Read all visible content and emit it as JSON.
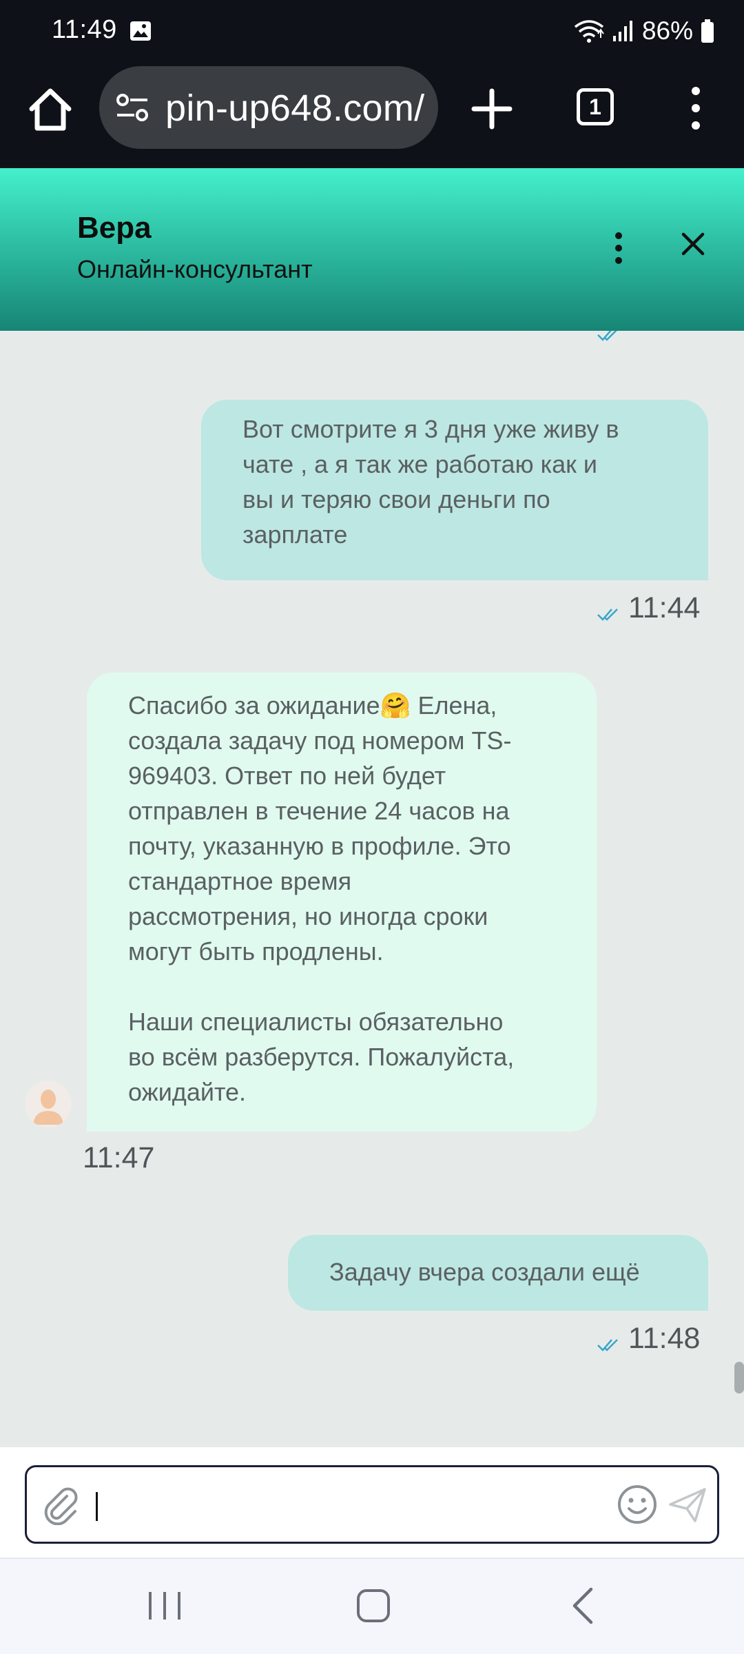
{
  "status_bar": {
    "time": "11:49",
    "battery": "86%"
  },
  "browser": {
    "url": "pin-up648.com/",
    "tab_count": "1"
  },
  "chat_header": {
    "agent_name": "Вера",
    "agent_role": "Онлайн-консультант"
  },
  "messages": [
    {
      "direction": "out",
      "lines": [
        "Вот смотрите я 3 дня уже живу в",
        "чате , а я так же работаю как и",
        "вы и теряю свои деньги по",
        "зарплате"
      ],
      "time": "11:44"
    },
    {
      "direction": "in",
      "lines": [
        "Спасибо за ожидание🤗 Елена,",
        "создала задачу под номером TS-",
        "969403. Ответ по ней будет",
        "отправлен в течение 24 часов на",
        "почту, указанную в профиле. Это",
        "стандартное время",
        "рассмотрения, но иногда сроки",
        "могут быть продлены."
      ],
      "lines2": [
        "Наши специалисты обязательно",
        "во всём разберутся. Пожалуйста,",
        "ожидайте."
      ],
      "time": "11:47"
    },
    {
      "direction": "out",
      "lines": [
        "Задачу вчера создали ещё"
      ],
      "time": "11:48"
    }
  ],
  "input": {
    "value": "",
    "placeholder": ""
  },
  "colors": {
    "header_top": "#44f0cc",
    "header_bottom": "#178575",
    "bubble_out": "#bde7e2",
    "bubble_in": "#e0faef",
    "read_check": "#3aa6c9"
  }
}
